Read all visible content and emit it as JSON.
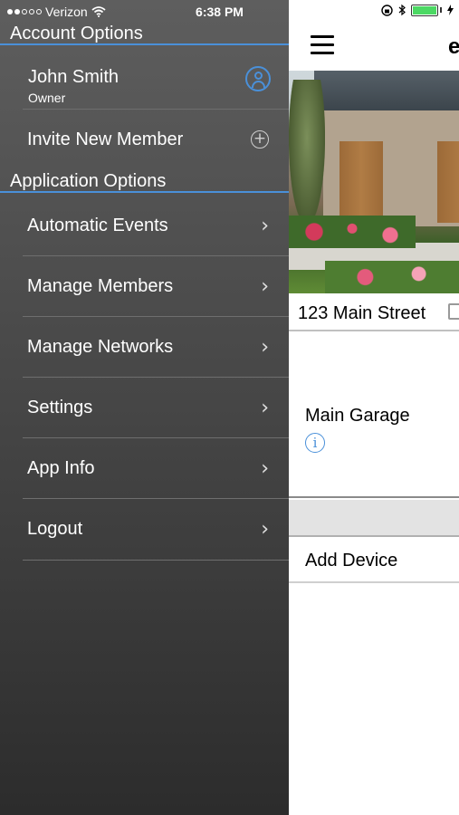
{
  "status_bar": {
    "carrier": "Verizon",
    "time": "6:38 PM"
  },
  "drawer": {
    "account_header": "Account Options",
    "user": {
      "name": "John Smith",
      "role": "Owner"
    },
    "invite_label": "Invite New Member",
    "app_header": "Application Options",
    "items": [
      {
        "label": "Automatic Events"
      },
      {
        "label": "Manage Members"
      },
      {
        "label": "Manage Networks"
      },
      {
        "label": "Settings"
      },
      {
        "label": "App Info"
      },
      {
        "label": "Logout"
      }
    ],
    "accent_color": "#4a90d9"
  },
  "main": {
    "brand_partial": "e",
    "address": "123 Main Street",
    "device_name": "Main Garage",
    "add_device_label": "Add Device"
  },
  "icons": {
    "chevron": "chevron-right-icon",
    "plus": "plus-circle-icon",
    "user": "user-circle-icon",
    "info": "info-icon",
    "menu": "hamburger-menu-icon",
    "edit": "edit-icon",
    "wifi": "wifi-icon",
    "bluetooth": "bluetooth-icon",
    "battery": "battery-icon"
  }
}
